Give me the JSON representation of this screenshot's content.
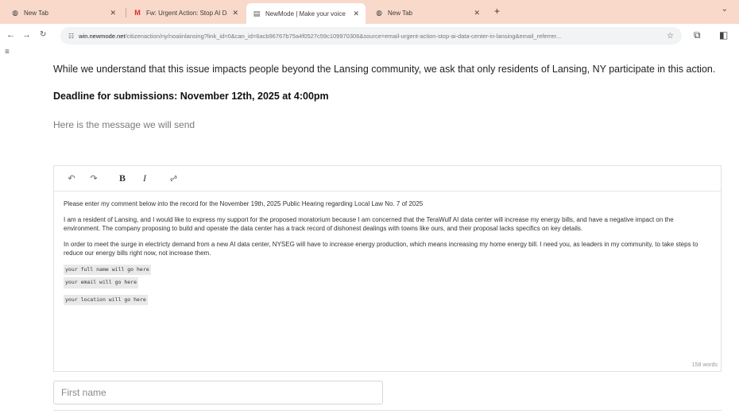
{
  "browser": {
    "tabs": [
      {
        "title": "New Tab",
        "favicon": "globe-icon",
        "active": false
      },
      {
        "title": "Fw: Urgent Action: Stop AI Dat",
        "favicon": "gmail-icon",
        "active": false
      },
      {
        "title": "NewMode | Make your voice",
        "favicon": "newmode-icon",
        "active": true
      },
      {
        "title": "New Tab",
        "favicon": "globe-icon",
        "active": false
      }
    ],
    "new_tab_label": "+",
    "tab_search_label": "⌄",
    "address": {
      "host": "win.newmode.net",
      "path": "/citizenaction/ny/noaiinlansing?link_id=0&can_id=6acb96767b75a4f0527c59c109970306&source=email-urgent-action-stop-ai-data-center-in-lansing&email_referrer..."
    }
  },
  "page": {
    "intro_text": "While we understand that this issue impacts people beyond the Lansing community, we ask that only residents of Lansing, NY participate in this action.",
    "deadline_text": "Deadline for submissions:  November 12th, 2025 at 4:00pm",
    "message_heading": "Here is the message we will send",
    "editor": {
      "paragraphs": [
        "Please enter my comment below into the record for the November 19th, 2025 Public Hearing regarding Local Law No. 7 of 2025",
        "I am a resident of Lansing, and I would like to express my support for the proposed moratorium because I am concerned that the TeraWulf AI data center will increase my energy bills, and have a negative impact on the environment. The company proposing to build and operate the data center has a track record of dishonest dealings with towns like ours, and their proposal lacks specifics on key details.",
        "In order to meet the surge in electricty demand from a new AI data center, NYSEG will have to increase energy production, which means increasing my home energy bill. I need you, as leaders in my community, to take steps to reduce our energy bills right now, not increase them."
      ],
      "placeholders": {
        "full_name": "your full name will go here",
        "email": "your email will go here",
        "location": "your location will go here"
      },
      "word_count": "158 words"
    },
    "first_name_placeholder": "First name"
  }
}
